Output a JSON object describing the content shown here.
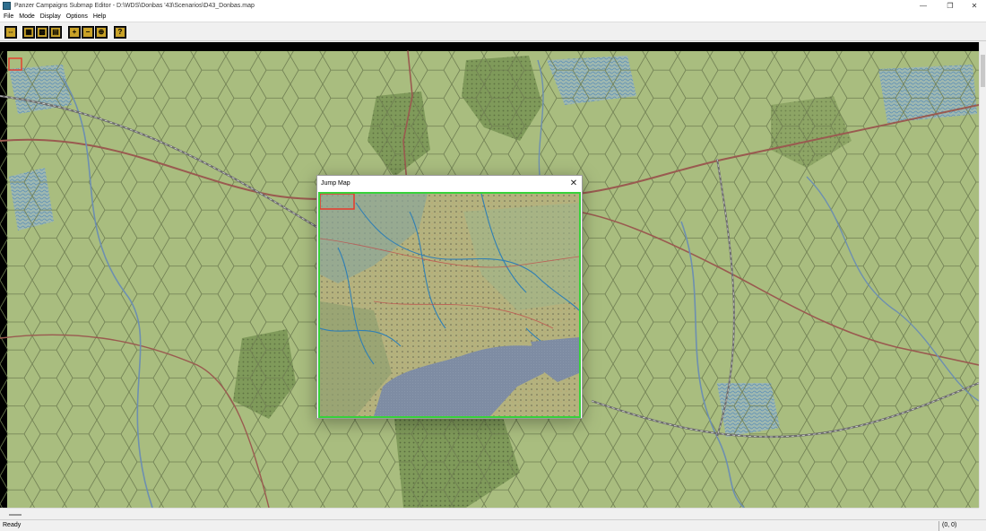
{
  "window": {
    "title": "Panzer Campaigns Submap Editor - D:\\WDS\\Donbas '43\\Scenarios\\D43_Donbas.map",
    "controls": {
      "minimize": "—",
      "restore": "❐",
      "close": "✕"
    }
  },
  "menu": {
    "items": [
      "File",
      "Mode",
      "Display",
      "Options",
      "Help"
    ]
  },
  "toolbar": {
    "buttons": [
      {
        "name": "scroll-button",
        "glyph": "⇔"
      },
      {
        "name": "open-button",
        "glyph": "▦"
      },
      {
        "name": "submap-button",
        "glyph": "▩"
      },
      {
        "name": "save-button",
        "glyph": "▤"
      },
      {
        "name": "zoom-in-button",
        "glyph": "+"
      },
      {
        "name": "zoom-out-button",
        "glyph": "−"
      },
      {
        "name": "jump-button",
        "glyph": "⊕"
      },
      {
        "name": "help-button",
        "glyph": "?"
      }
    ]
  },
  "jump_map": {
    "title": "Jump Map",
    "close_glyph": "✕"
  },
  "status": {
    "ready": "Ready",
    "coords": "(0, 0)"
  },
  "colors": {
    "accent_frame": "#37d23a",
    "selection": "#e8382a",
    "terrain_clear": "#a8bd7c"
  }
}
